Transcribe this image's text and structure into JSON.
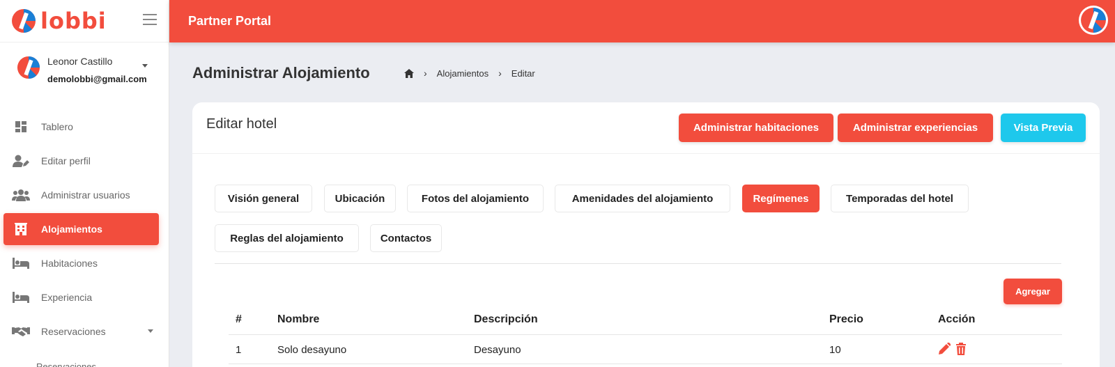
{
  "brand": {
    "name": "lobbi",
    "accent": "#f24d3d"
  },
  "topbar": {
    "title": "Partner Portal"
  },
  "user": {
    "name": "Leonor Castillo",
    "email": "demolobbi@gmail.com"
  },
  "sidebar": {
    "items": [
      {
        "label": "Tablero",
        "icon": "dashboard-icon"
      },
      {
        "label": "Editar perfil",
        "icon": "user-edit-icon"
      },
      {
        "label": "Administrar usuarios",
        "icon": "users-icon"
      },
      {
        "label": "Alojamientos",
        "icon": "building-icon",
        "active": true
      },
      {
        "label": "Habitaciones",
        "icon": "bed-icon"
      },
      {
        "label": "Experiencia",
        "icon": "bed-icon"
      },
      {
        "label": "Reservaciones",
        "icon": "handshake-icon"
      }
    ],
    "sub_item": "Reservaciones"
  },
  "page": {
    "title": "Administrar Alojamiento",
    "breadcrumb": [
      "Alojamientos",
      "Editar"
    ]
  },
  "card": {
    "title": "Editar hotel",
    "buttons": {
      "rooms": "Administrar habitaciones",
      "experiences": "Administrar experiencias",
      "preview": "Vista Previa"
    },
    "tabs": [
      "Visión general",
      "Ubicación",
      "Fotos del alojamiento",
      "Amenidades del alojamiento",
      "Regímenes",
      "Temporadas del hotel",
      "Reglas del alojamiento",
      "Contactos"
    ],
    "active_tab": "Regímenes",
    "add_label": "Agregar",
    "table": {
      "headers": [
        "#",
        "Nombre",
        "Descripción",
        "Precio",
        "Acción"
      ],
      "rows": [
        {
          "id": "1",
          "name": "Solo desayuno",
          "description": "Desayuno",
          "price": "10"
        }
      ]
    }
  }
}
